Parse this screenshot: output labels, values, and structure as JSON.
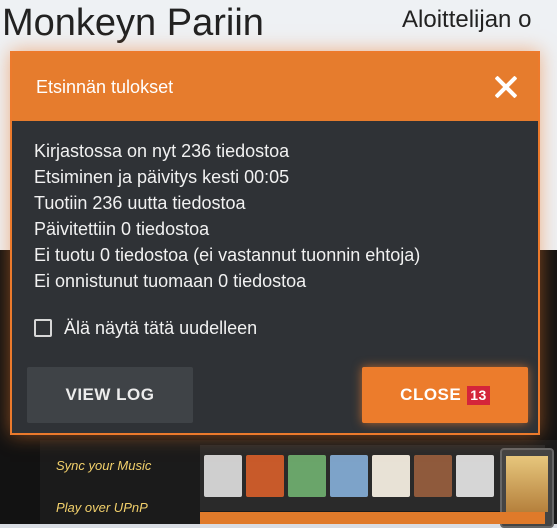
{
  "background": {
    "title": "Monkeyn Pariin",
    "subtitle": "Aloittelijan o",
    "captions": [
      "Sync your Music",
      "Play over UPnP"
    ]
  },
  "dialog": {
    "title": "Etsinnän tulokset",
    "results": [
      "Kirjastossa on nyt 236 tiedostoa",
      "Etsiminen ja päivitys kesti 00:05",
      "Tuotiin 236 uutta tiedostoa",
      "Päivitettiin 0 tiedostoa",
      "Ei tuotu 0 tiedostoa (ei vastannut tuonnin ehtoja)",
      "Ei onnistunut tuomaan 0 tiedostoa"
    ],
    "dont_show_label": "Älä näytä tätä uudelleen",
    "dont_show_checked": false,
    "view_log_label": "VIEW LOG",
    "close_label": "CLOSE",
    "close_badge": "13"
  },
  "colors": {
    "accent": "#e67c2d",
    "dialog_bg": "#2f3236",
    "secondary_button": "#3f4347",
    "badge": "#d4253a"
  },
  "icons": {
    "dialog_close": "close-icon"
  }
}
